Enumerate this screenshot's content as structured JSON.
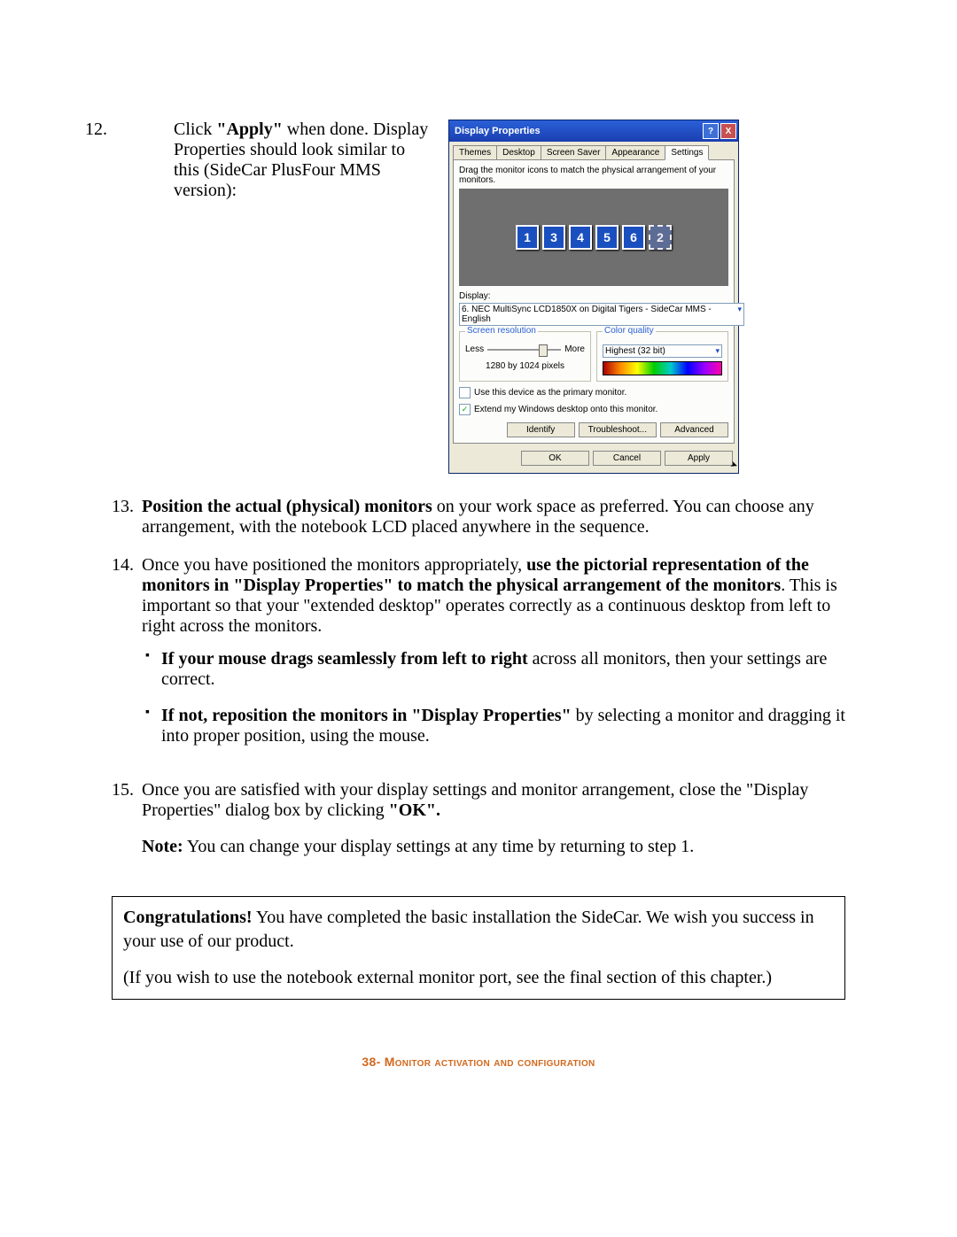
{
  "steps": {
    "s12": {
      "num": "12.",
      "pre": "Click ",
      "bold": "\"Apply\"",
      "post": " when done. Display Properties should look similar to this (SideCar PlusFour MMS version):"
    },
    "s13": {
      "num": "13.",
      "bold": "Position the actual (physical) monitors",
      "post": " on your work space as preferred. You can choose any arrangement, with the notebook LCD placed anywhere in the sequence."
    },
    "s14": {
      "num": "14.",
      "pre": "Once you have positioned the monitors appropriately, ",
      "bold": "use the pictorial representation of the monitors in \"Display Properties\" to match the physical arrangement of the monitors",
      "post": ". This is important so that your \"extended desktop\" operates correctly as a continuous desktop from left to right across the monitors.",
      "bul1_bold": "If your mouse drags seamlessly from left to right",
      "bul1_post": " across all monitors, then your settings are correct.",
      "bul2_bold": "If not, reposition the monitors in \"Display Properties\"",
      "bul2_post": " by selecting a monitor and dragging it into proper position, using the mouse."
    },
    "s15": {
      "num": "15.",
      "pre": "Once you are satisfied with your display settings and monitor arrangement, close the \"Display Properties\" dialog box by clicking ",
      "bold": "\"OK\".",
      "note_b": "Note:",
      "note": " You can change your display settings at any time by returning to step 1."
    }
  },
  "dp": {
    "title": "Display Properties",
    "tabs": [
      "Themes",
      "Desktop",
      "Screen Saver",
      "Appearance",
      "Settings"
    ],
    "active_tab": 4,
    "instruction": "Drag the monitor icons to match the physical arrangement of your monitors.",
    "monitors": [
      {
        "n": "1",
        "ghost": false
      },
      {
        "n": "3",
        "ghost": false
      },
      {
        "n": "4",
        "ghost": false
      },
      {
        "n": "5",
        "ghost": false
      },
      {
        "n": "6",
        "ghost": false
      },
      {
        "n": "2",
        "ghost": true
      }
    ],
    "display_label": "Display:",
    "display_value": "6. NEC MultiSync LCD1850X on Digital Tigers - SideCar MMS - English",
    "res_title": "Screen resolution",
    "res_less": "Less",
    "res_more": "More",
    "res_value": "1280 by 1024 pixels",
    "cq_title": "Color quality",
    "cq_value": "Highest (32 bit)",
    "chk1": "Use this device as the primary monitor.",
    "chk1_checked": false,
    "chk2": "Extend my Windows desktop onto this monitor.",
    "chk2_checked": true,
    "btn_identify": "Identify",
    "btn_troubleshoot": "Troubleshoot...",
    "btn_advanced": "Advanced",
    "btn_ok": "OK",
    "btn_cancel": "Cancel",
    "btn_apply": "Apply"
  },
  "congrats": {
    "bold": "Congratulations!",
    "text": " You have completed the basic installation the SideCar. We wish you success in your use of our product.",
    "p2": "(If you wish to use the notebook external monitor port, see the final section of this chapter.)"
  },
  "footer": {
    "page": "38-",
    "chapter": " Monitor activation and configuration"
  }
}
